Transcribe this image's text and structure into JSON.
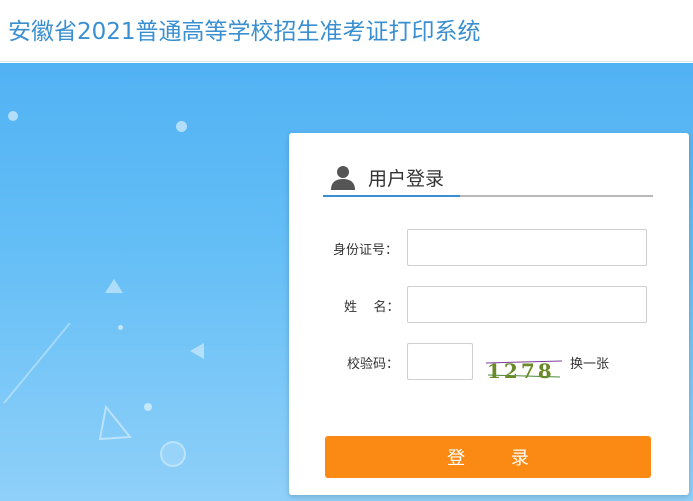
{
  "header": {
    "title": "安徽省2021普通高等学校招生准考证打印系统"
  },
  "login": {
    "title": "用户登录",
    "id_label": "身份证号：",
    "id_value": "",
    "name_label": "姓    名：",
    "name_value": "",
    "captcha_label": "校验码：",
    "captcha_value": "",
    "captcha_text": "1278",
    "refresh_label": "换一张",
    "submit_label": "登 录"
  },
  "colors": {
    "header_title": "#3a8fd0",
    "accent": "#3a8fd0",
    "button": "#fb8a14",
    "background": "#51b2f4"
  }
}
